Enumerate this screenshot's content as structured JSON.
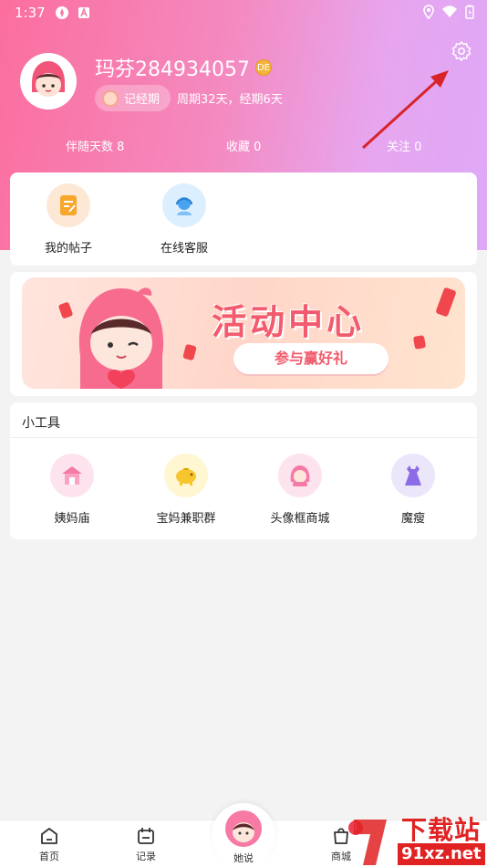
{
  "status_bar": {
    "time": "1:37"
  },
  "profile": {
    "username": "玛芬284934057",
    "coin_badge": "DE",
    "period_button": "记经期",
    "cycle_info": "周期32天，经期6天"
  },
  "stats": [
    {
      "label": "伴随天数 8"
    },
    {
      "label": "收藏 0"
    },
    {
      "label": "关注 0"
    }
  ],
  "quick_actions": [
    {
      "label": "我的帖子",
      "icon": "post-icon"
    },
    {
      "label": "在线客服",
      "icon": "customer-service-icon"
    }
  ],
  "banner": {
    "title": "活动中心",
    "button": "参与赢好礼"
  },
  "tools": {
    "title": "小工具",
    "items": [
      {
        "label": "姨妈庙",
        "icon": "temple-icon"
      },
      {
        "label": "宝妈兼职群",
        "icon": "piggy-bank-icon"
      },
      {
        "label": "头像框商城",
        "icon": "avatar-frame-icon"
      },
      {
        "label": "魔瘦",
        "icon": "dress-icon"
      }
    ]
  },
  "tab_bar": {
    "items": [
      {
        "label": "首页",
        "icon": "home-icon"
      },
      {
        "label": "记录",
        "icon": "calendar-icon"
      },
      {
        "label": "她说",
        "icon": "mascot-icon"
      },
      {
        "label": "商城",
        "icon": "bag-icon"
      }
    ],
    "cart_badge": "1"
  },
  "watermark": {
    "title": "下载站",
    "url": "91xz.net"
  },
  "colors": {
    "header_gradient_start": "#fb6e9e",
    "header_gradient_end": "#dea8f7",
    "accent_red": "#f25b6d",
    "badge_red": "#ef3d52"
  }
}
